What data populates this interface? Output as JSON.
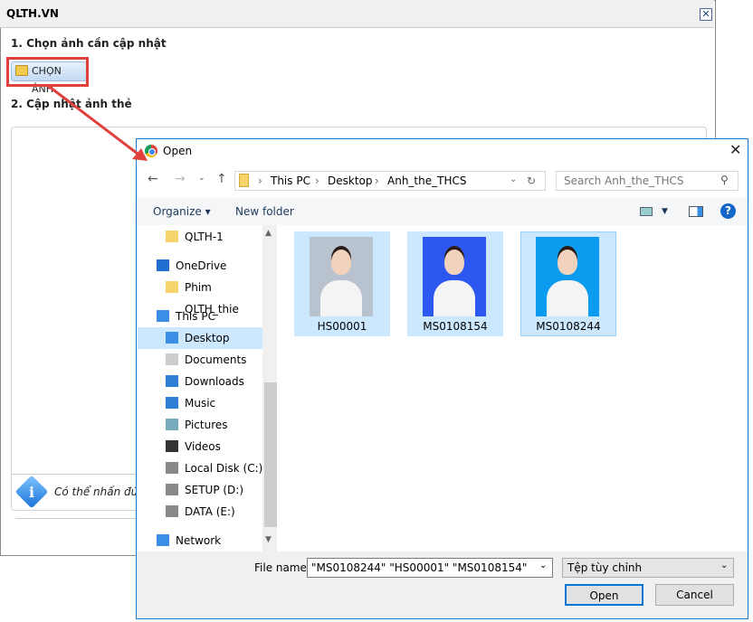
{
  "app": {
    "title": "QLTH.VN",
    "close": "✕",
    "step1": "1. Chọn ảnh cần cập nhật",
    "choose_button": "CHỌN ẢNH",
    "step2": "2. Cập nhật ảnh thẻ",
    "info_text": "Có thể nhấn đúp",
    "highlight_color": "#e0413d"
  },
  "dialog": {
    "title": "Open",
    "close": "✕",
    "breadcrumb": [
      "This PC",
      "Desktop",
      "Anh_the_THCS"
    ],
    "search_placeholder": "Search Anh_the_THCS",
    "toolbar": {
      "organize": "Organize ▾",
      "new_folder": "New folder"
    },
    "nav": [
      {
        "label": "QLTH-1",
        "icon": "folder-icon"
      },
      {
        "label": "OneDrive",
        "icon": "cloud-icon"
      },
      {
        "label": "Phim QLTH_thie",
        "icon": "folder-icon"
      },
      {
        "label": "This PC",
        "icon": "computer-icon"
      },
      {
        "label": "Desktop",
        "icon": "desktop-icon",
        "selected": true
      },
      {
        "label": "Documents",
        "icon": "document-icon"
      },
      {
        "label": "Downloads",
        "icon": "download-icon"
      },
      {
        "label": "Music",
        "icon": "music-icon"
      },
      {
        "label": "Pictures",
        "icon": "pictures-icon"
      },
      {
        "label": "Videos",
        "icon": "videos-icon"
      },
      {
        "label": "Local Disk (C:)",
        "icon": "drive-icon"
      },
      {
        "label": "SETUP (D:)",
        "icon": "drive-icon"
      },
      {
        "label": "DATA (E:)",
        "icon": "drive-icon"
      },
      {
        "label": "Network",
        "icon": "network-icon"
      }
    ],
    "files": [
      {
        "name": "HS00001",
        "bg": "#b9c3cf"
      },
      {
        "name": "MS0108154",
        "bg": "#2c57f0"
      },
      {
        "name": "MS0108244",
        "bg": "#0b9cf0"
      }
    ],
    "file_name_label": "File name:",
    "file_name_value": "\"MS0108244\" \"HS00001\" \"MS0108154\"",
    "file_type": "Tệp tùy chỉnh",
    "open": "Open",
    "cancel": "Cancel"
  }
}
